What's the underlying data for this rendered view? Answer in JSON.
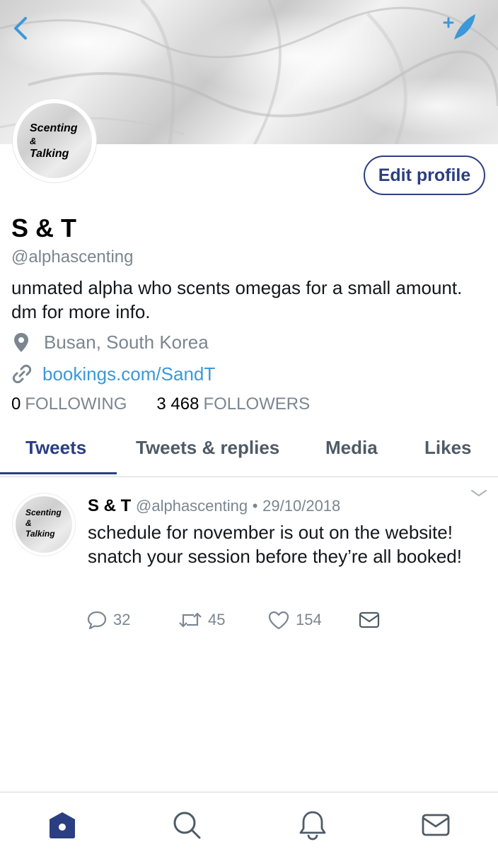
{
  "header": {
    "back_icon": "chevron-left-icon",
    "compose_icon": "compose-feather-icon",
    "accent": "#3c98d8"
  },
  "profile": {
    "avatar_text": [
      "Scenting",
      "&",
      "Talking"
    ],
    "edit_button": "Edit profile",
    "name": "S & T",
    "handle": "@alphascenting",
    "bio": "unmated alpha who scents omegas for a small amount. dm for more info.",
    "location": "Busan, South Korea",
    "link": "bookings.com/SandT",
    "following_count": "0",
    "following_label": "FOLLOWING",
    "followers_count": "3 468",
    "followers_label": "FOLLOWERS"
  },
  "tabs": [
    {
      "label": "Tweets",
      "active": true
    },
    {
      "label": "Tweets & replies",
      "active": false
    },
    {
      "label": "Media",
      "active": false
    },
    {
      "label": "Likes",
      "active": false
    }
  ],
  "tweet": {
    "avatar_text": [
      "Scenting",
      "&",
      "Talking"
    ],
    "name": "S & T",
    "handle": "@alphascenting",
    "separator": "•",
    "date": "29/10/2018",
    "text": "schedule for november is out on the website! snatch your session before they’re all booked!",
    "replies": "32",
    "retweets": "45",
    "likes": "154"
  },
  "bottom_nav": {
    "items": [
      "home-icon",
      "search-icon",
      "notifications-bell-icon",
      "messages-envelope-icon"
    ],
    "active_color": "#2b3e82",
    "inactive_color": "#4f5b66"
  }
}
